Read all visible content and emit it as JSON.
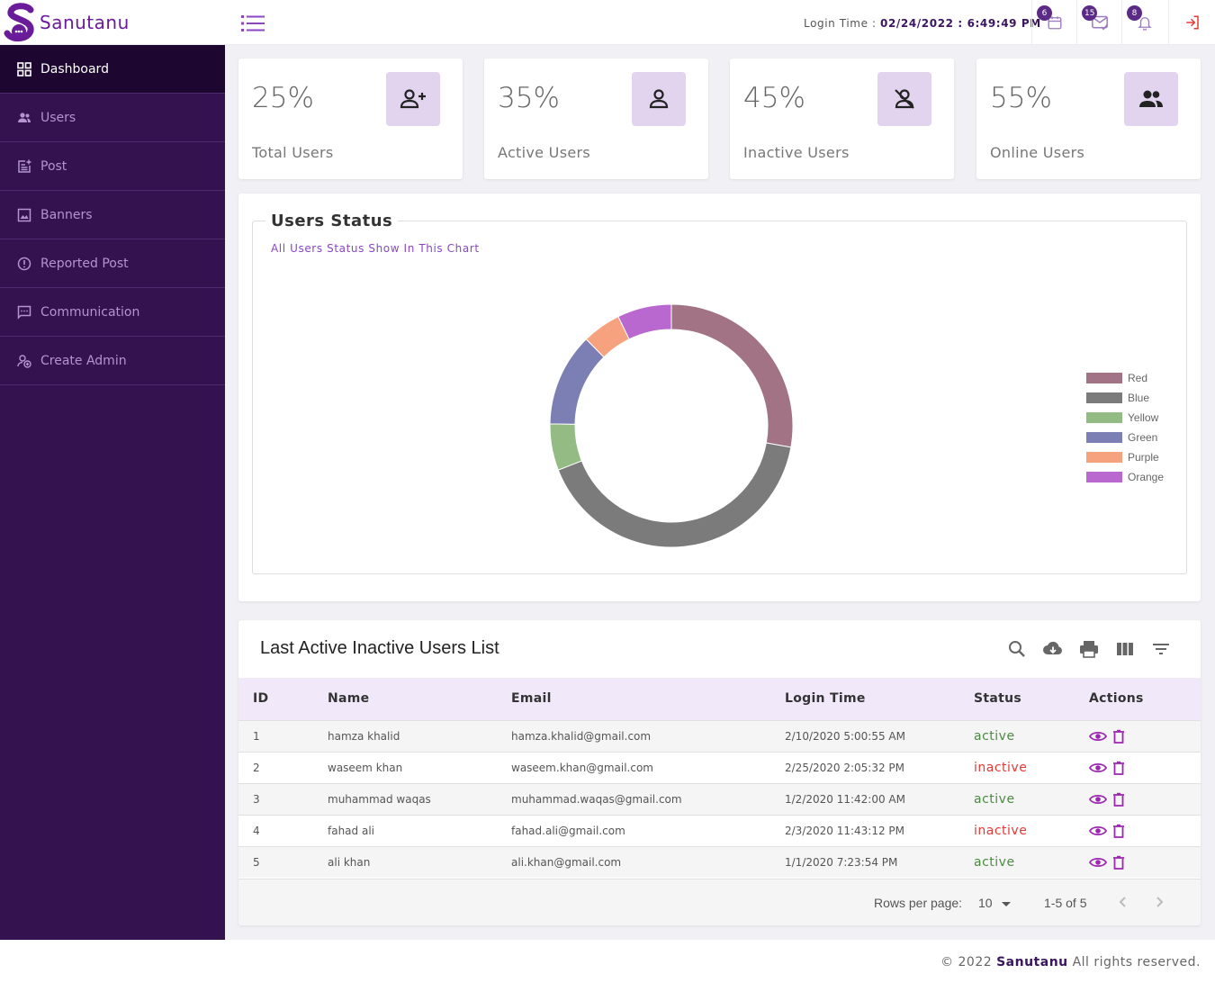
{
  "brand": {
    "name": "Sanutanu",
    "primary": "#34124f",
    "accent": "#6a1b9a"
  },
  "header": {
    "login_label": "Login Time : ",
    "login_date": "02/24/2022",
    "login_sep": " : ",
    "login_time": "6:49:49 PM",
    "badges": {
      "calendar": "6",
      "mail": "15",
      "bell": "8"
    }
  },
  "sidebar": {
    "items": [
      {
        "label": "Dashboard",
        "icon": "dashboard-grid-icon",
        "active": true
      },
      {
        "label": "Users",
        "icon": "users-icon"
      },
      {
        "label": "Post",
        "icon": "post-add-icon"
      },
      {
        "label": "Banners",
        "icon": "image-icon"
      },
      {
        "label": "Reported Post",
        "icon": "report-icon"
      },
      {
        "label": "Communication",
        "icon": "chat-icon"
      },
      {
        "label": "Create Admin",
        "icon": "admin-add-icon"
      }
    ]
  },
  "cards": [
    {
      "value": "25%",
      "label": "Total Users",
      "icon": "person-add-icon"
    },
    {
      "value": "35%",
      "label": "Active Users",
      "icon": "person-icon"
    },
    {
      "value": "45%",
      "label": "Inactive Users",
      "icon": "person-off-icon"
    },
    {
      "value": "55%",
      "label": "Online Users",
      "icon": "people-icon"
    }
  ],
  "chart_panel": {
    "title": "Users Status",
    "subtitle": "All Users Status Show In This Chart"
  },
  "chart_data": {
    "type": "pie",
    "labels": [
      "Red",
      "Blue",
      "Yellow",
      "Green",
      "Purple",
      "Orange"
    ],
    "values": [
      27,
      40,
      6,
      12,
      5,
      7
    ],
    "colors": [
      "#a17385",
      "#7b7b7b",
      "#93bb83",
      "#7b7fb4",
      "#f7a27f",
      "#b868cf"
    ],
    "legend": "right"
  },
  "table": {
    "title": "Last Active Inactive Users List",
    "columns": [
      "ID",
      "Name",
      "Email",
      "Login Time",
      "Status",
      "Actions"
    ],
    "rows": [
      {
        "id": "1",
        "name": "hamza khalid",
        "email": "hamza.khalid@gmail.com",
        "login": "2/10/2020 5:00:55 AM",
        "status": "active"
      },
      {
        "id": "2",
        "name": "waseem khan",
        "email": "waseem.khan@gmail.com",
        "login": "2/25/2020 2:05:32 PM",
        "status": "inactive"
      },
      {
        "id": "3",
        "name": "muhammad waqas",
        "email": "muhammad.waqas@gmail.com",
        "login": "1/2/2020 11:42:00 AM",
        "status": "active"
      },
      {
        "id": "4",
        "name": "fahad ali",
        "email": "fahad.ali@gmail.com",
        "login": "2/3/2020 11:43:12 PM",
        "status": "inactive"
      },
      {
        "id": "5",
        "name": "ali khan",
        "email": "ali.khan@gmail.com",
        "login": "1/1/2020 7:23:54 PM",
        "status": "active"
      }
    ],
    "pagination": {
      "rows_label": "Rows per page:",
      "rows_value": "10",
      "range": "1-5 of 5"
    }
  },
  "footer": {
    "prefix": "© 2022 ",
    "brand": "Sanutanu",
    "suffix": " All rights reserved."
  }
}
